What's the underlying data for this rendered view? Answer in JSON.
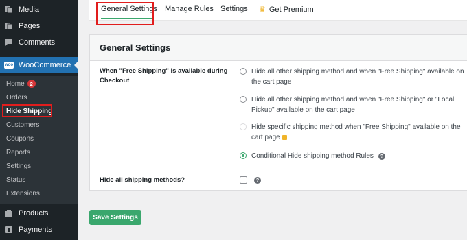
{
  "sidebar": {
    "top_items": [
      {
        "label": "Media",
        "icon": "media-icon"
      },
      {
        "label": "Pages",
        "icon": "pages-icon"
      },
      {
        "label": "Comments",
        "icon": "comments-icon"
      }
    ],
    "woocommerce": {
      "label": "WooCommerce",
      "logo_text": "woo"
    },
    "submenu": [
      {
        "label": "Home",
        "badge": "2"
      },
      {
        "label": "Orders"
      },
      {
        "label": "Hide Shipping"
      },
      {
        "label": "Customers"
      },
      {
        "label": "Coupons"
      },
      {
        "label": "Reports"
      },
      {
        "label": "Settings"
      },
      {
        "label": "Status"
      },
      {
        "label": "Extensions"
      }
    ],
    "bottom_items": [
      {
        "label": "Products",
        "icon": "products-icon"
      },
      {
        "label": "Payments",
        "icon": "payments-icon"
      }
    ]
  },
  "tabs": [
    {
      "label": "General Settings"
    },
    {
      "label": "Manage Rules"
    },
    {
      "label": "Settings"
    },
    {
      "label": "Get Premium",
      "icon": "crown-icon"
    }
  ],
  "panel": {
    "title": "General Settings",
    "row1_label": "When \"Free Shipping\" is available during Checkout",
    "options": [
      {
        "text": "Hide all other shipping method and when \"Free Shipping\" available on the cart page",
        "state": "unchecked"
      },
      {
        "text": "Hide all other shipping method and when \"Free Shipping\" or \"Local Pickup\" available on the cart page",
        "state": "unchecked"
      },
      {
        "text": "Hide specific shipping method when \"Free Shipping\" available on the cart page",
        "state": "disabled"
      },
      {
        "text": "Conditional Hide shipping method Rules",
        "state": "checked"
      }
    ],
    "row2_label": "Hide all shipping methods?",
    "help_glyph": "?"
  },
  "save_button": "Save Settings",
  "colors": {
    "sidebar_bg": "#1d2327",
    "submenu_bg": "#2c3338",
    "wp_blue": "#2271b1",
    "accent_green": "#3aa76d",
    "highlight_red": "#e11d1d",
    "badge_red": "#d63638"
  }
}
